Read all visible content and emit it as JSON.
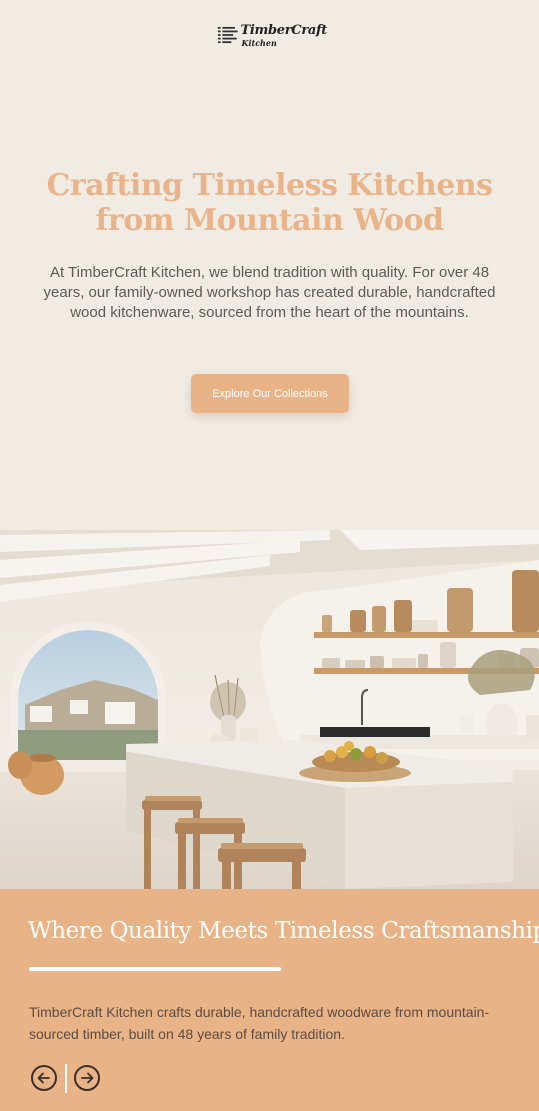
{
  "brand": {
    "name": "TimberCraft",
    "sub": "Kitchen"
  },
  "hero": {
    "title_line1": "Crafting Timeless Kitchens",
    "title_line2": "from Mountain Wood",
    "text": "At TimberCraft Kitchen, we blend tradition with quality. For over 48 years, our family-owned workshop has created durable, handcrafted wood kitchenware, sourced from the heart of the mountains.",
    "cta_label": "Explore Our Collections"
  },
  "feature": {
    "title": "Where Quality Meets Timeless Craftsmanship",
    "text": "TimberCraft Kitchen crafts durable, handcrafted woodware from mountain-sourced timber, built on 48 years of family tradition.",
    "prev_icon": "arrow-left-circle-icon",
    "next_icon": "arrow-right-circle-icon"
  },
  "colors": {
    "background": "#f0ebe3",
    "accent": "#e8b386",
    "title": "#e9b48a"
  }
}
